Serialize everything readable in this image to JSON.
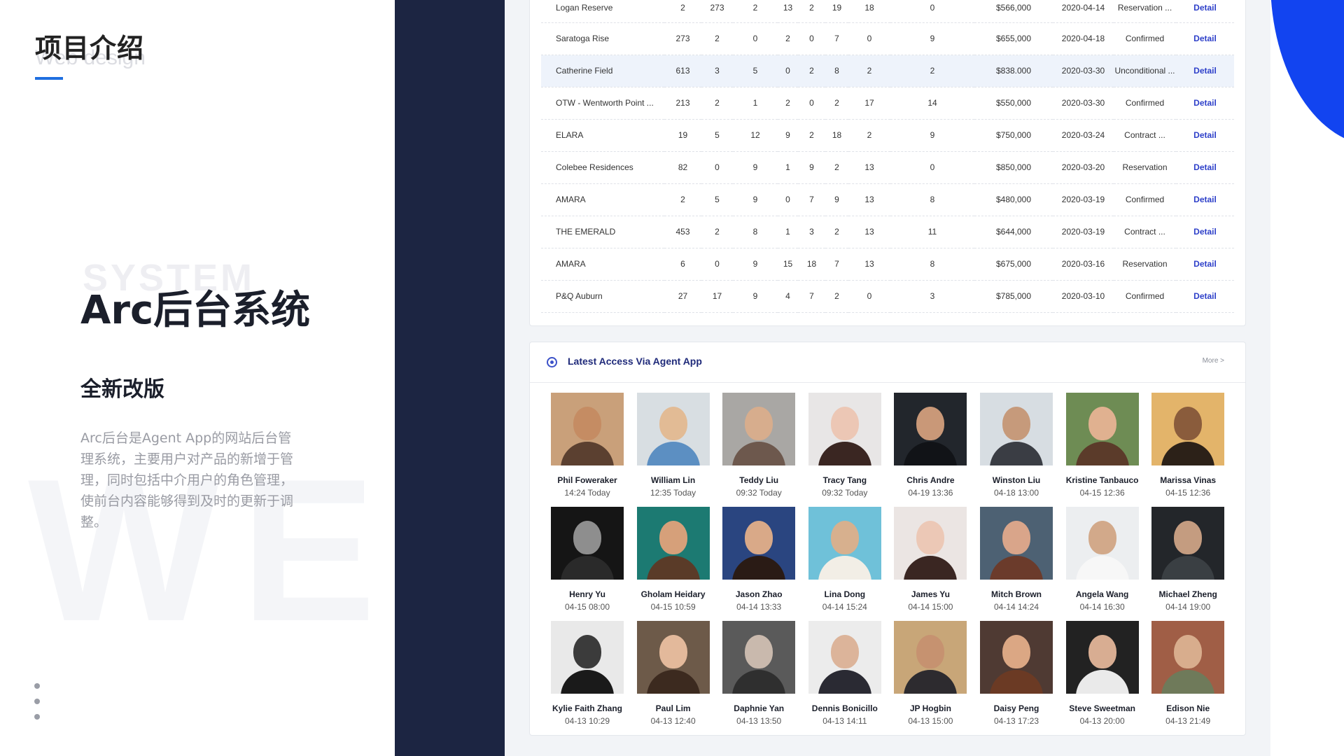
{
  "left": {
    "section_title": "项目介绍",
    "section_ghost": "Web design",
    "system_ghost": "SYSTEM",
    "project_name": "Arc后台系统",
    "subtitle": "全新改版",
    "description": "Arc后台是Agent App的网站后台管理系统，主要用户对产品的新增于管理，同时包括中介用户的角色管理，使前台内容能够得到及时的更新于调整。",
    "watermark": "WEB"
  },
  "table": {
    "action_label": "Detail",
    "rows": [
      {
        "name": "Logan Reserve",
        "c1": "2",
        "c2": "273",
        "c3": "2",
        "c4": "13",
        "c5": "2",
        "c6": "19",
        "c7": "18",
        "c8": "0",
        "price": "$566,000",
        "date": "2020-04-14",
        "status": "Reservation ..."
      },
      {
        "name": "Saratoga Rise",
        "c1": "273",
        "c2": "2",
        "c3": "0",
        "c4": "2",
        "c5": "0",
        "c6": "7",
        "c7": "0",
        "c8": "9",
        "price": "$655,000",
        "date": "2020-04-18",
        "status": "Confirmed"
      },
      {
        "name": "Catherine Field",
        "c1": "613",
        "c2": "3",
        "c3": "5",
        "c4": "0",
        "c5": "2",
        "c6": "8",
        "c7": "2",
        "c8": "2",
        "price": "$838.000",
        "date": "2020-03-30",
        "status": "Unconditional ..."
      },
      {
        "name": "OTW - Wentworth Point ...",
        "c1": "213",
        "c2": "2",
        "c3": "1",
        "c4": "2",
        "c5": "0",
        "c6": "2",
        "c7": "17",
        "c8": "14",
        "price": "$550,000",
        "date": "2020-03-30",
        "status": "Confirmed"
      },
      {
        "name": "ELARA",
        "c1": "19",
        "c2": "5",
        "c3": "12",
        "c4": "9",
        "c5": "2",
        "c6": "18",
        "c7": "2",
        "c8": "9",
        "price": "$750,000",
        "date": "2020-03-24",
        "status": "Contract ..."
      },
      {
        "name": "Colebee Residences",
        "c1": "82",
        "c2": "0",
        "c3": "9",
        "c4": "1",
        "c5": "9",
        "c6": "2",
        "c7": "13",
        "c8": "0",
        "price": "$850,000",
        "date": "2020-03-20",
        "status": "Reservation"
      },
      {
        "name": "AMARA",
        "c1": "2",
        "c2": "5",
        "c3": "9",
        "c4": "0",
        "c5": "7",
        "c6": "9",
        "c7": "13",
        "c8": "8",
        "price": "$480,000",
        "date": "2020-03-19",
        "status": "Confirmed"
      },
      {
        "name": "THE EMERALD",
        "c1": "453",
        "c2": "2",
        "c3": "8",
        "c4": "1",
        "c5": "3",
        "c6": "2",
        "c7": "13",
        "c8": "11",
        "price": "$644,000",
        "date": "2020-03-19",
        "status": "Contract ..."
      },
      {
        "name": "AMARA",
        "c1": "6",
        "c2": "0",
        "c3": "9",
        "c4": "15",
        "c5": "18",
        "c6": "7",
        "c7": "13",
        "c8": "8",
        "price": "$675,000",
        "date": "2020-03-16",
        "status": "Reservation"
      },
      {
        "name": "P&Q Auburn",
        "c1": "27",
        "c2": "17",
        "c3": "9",
        "c4": "4",
        "c5": "7",
        "c6": "2",
        "c7": "0",
        "c8": "3",
        "price": "$785,000",
        "date": "2020-03-10",
        "status": "Confirmed"
      }
    ]
  },
  "access": {
    "title": "Latest Access Via Agent App",
    "more": "More >",
    "users": [
      {
        "name": "Phil Foweraker",
        "time": "14:24 Today",
        "bg": "#c9a07a",
        "skin": "#c58c63",
        "wear": "#5b4030"
      },
      {
        "name": "William Lin",
        "time": "12:35 Today",
        "bg": "#d8dee2",
        "skin": "#e2bb95",
        "wear": "#5c8fc2"
      },
      {
        "name": "Teddy Liu",
        "time": "09:32 Today",
        "bg": "#a9a7a4",
        "skin": "#d7ad8d",
        "wear": "#6d584d"
      },
      {
        "name": "Tracy Tang",
        "time": "09:32 Today",
        "bg": "#e8e6e6",
        "skin": "#ecc7b5",
        "wear": "#3a2622"
      },
      {
        "name": "Chris Andre",
        "time": "04-19 13:36",
        "bg": "#22262c",
        "skin": "#c99878",
        "wear": "#111317"
      },
      {
        "name": "Winston Liu",
        "time": "04-18 13:00",
        "bg": "#d7dde2",
        "skin": "#c69a7b",
        "wear": "#3a3d44"
      },
      {
        "name": "Kristine Tanbauco",
        "time": "04-15 12:36",
        "bg": "#6e8c54",
        "skin": "#e0b190",
        "wear": "#5b3b2a"
      },
      {
        "name": "Marissa Vinas",
        "time": "04-15 12:36",
        "bg": "#e3b46a",
        "skin": "#8a5c3c",
        "wear": "#2c2118"
      },
      {
        "name": "Henry Yu",
        "time": "04-15 08:00",
        "bg": "#151515",
        "skin": "#8e8e8e",
        "wear": "#2a2a2a"
      },
      {
        "name": "Gholam Heidary",
        "time": "04-15 10:59",
        "bg": "#1c7a72",
        "skin": "#d6a07a",
        "wear": "#5a3b28"
      },
      {
        "name": "Jason Zhao",
        "time": "04-14 13:33",
        "bg": "#2a4580",
        "skin": "#d9a988",
        "wear": "#2a1b15"
      },
      {
        "name": "Lina Dong",
        "time": "04-14 15:24",
        "bg": "#6fc1d9",
        "skin": "#d7b08e",
        "wear": "#f2eee6"
      },
      {
        "name": "James Yu",
        "time": "04-14 15:00",
        "bg": "#ebe5e3",
        "skin": "#ecc8b6",
        "wear": "#3a2622"
      },
      {
        "name": "Mitch Brown",
        "time": "04-14 14:24",
        "bg": "#4d6173",
        "skin": "#d9a58a",
        "wear": "#6b3b2b"
      },
      {
        "name": "Angela Wang",
        "time": "04-14 16:30",
        "bg": "#eceef0",
        "skin": "#d2a98a",
        "wear": "#f7f7f7"
      },
      {
        "name": "Michael Zheng",
        "time": "04-14 19:00",
        "bg": "#23262a",
        "skin": "#c49c80",
        "wear": "#3a3f43"
      },
      {
        "name": "Kylie Faith Zhang",
        "time": "04-13 10:29",
        "bg": "#e9e9e9",
        "skin": "#3b3b3b",
        "wear": "#1a1a1a"
      },
      {
        "name": "Paul Lim",
        "time": "04-13 12:40",
        "bg": "#6d5a49",
        "skin": "#e3b99b",
        "wear": "#3c2a1f"
      },
      {
        "name": "Daphnie Yan",
        "time": "04-13 13:50",
        "bg": "#5a5a5a",
        "skin": "#c9b9ad",
        "wear": "#2f2f2f"
      },
      {
        "name": "Dennis Bonicillo",
        "time": "04-13 14:11",
        "bg": "#ececec",
        "skin": "#dcb49a",
        "wear": "#2a2a33"
      },
      {
        "name": "JP Hogbin",
        "time": "04-13 15:00",
        "bg": "#c8a678",
        "skin": "#c69270",
        "wear": "#2d2b2f"
      },
      {
        "name": "Daisy Peng",
        "time": "04-13 17:23",
        "bg": "#4f3a33",
        "skin": "#dba784",
        "wear": "#6b3a24"
      },
      {
        "name": "Steve Sweetman",
        "time": "04-13 20:00",
        "bg": "#222",
        "skin": "#d8ad92",
        "wear": "#eaeaea"
      },
      {
        "name": "Edison Nie",
        "time": "04-13 21:49",
        "bg": "#a05e46",
        "skin": "#d8ad8d",
        "wear": "#6f7a5a"
      }
    ]
  }
}
